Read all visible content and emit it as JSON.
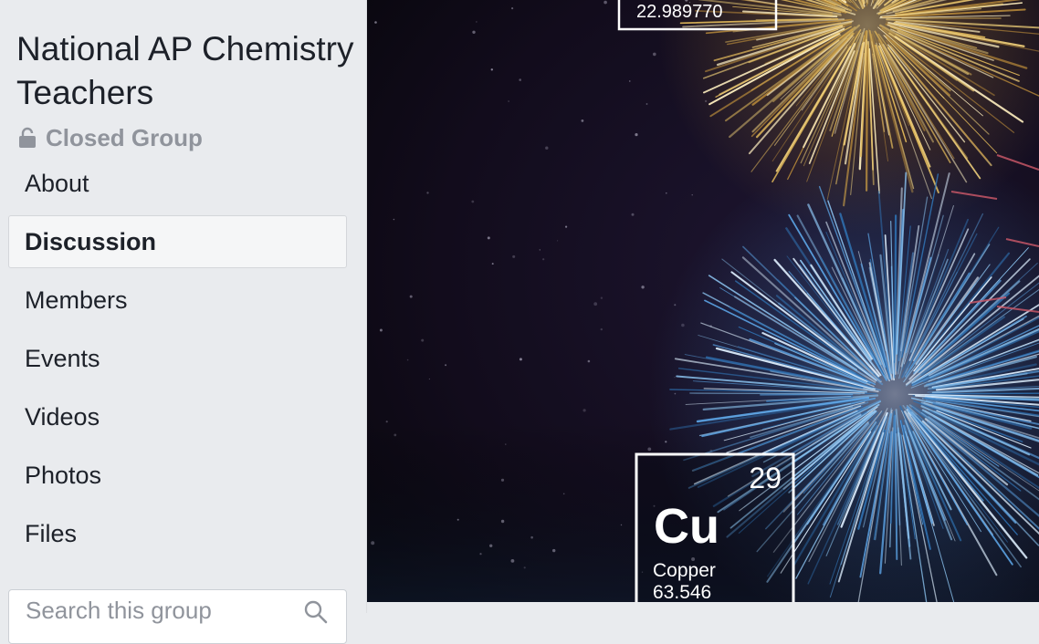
{
  "group": {
    "name": "National AP Chemistry Teachers",
    "privacy": "Closed Group"
  },
  "nav": {
    "items": [
      {
        "label": "About"
      },
      {
        "label": "Discussion"
      },
      {
        "label": "Members"
      },
      {
        "label": "Events"
      },
      {
        "label": "Videos"
      },
      {
        "label": "Photos"
      },
      {
        "label": "Files"
      }
    ],
    "active": "Discussion"
  },
  "search": {
    "placeholder": "Search this group"
  },
  "cover": {
    "sodium_tile": {
      "mass": "22.989770"
    },
    "copper_tile": {
      "number": "29",
      "symbol": "Cu",
      "name": "Copper",
      "mass": "63.546"
    }
  },
  "colors": {
    "sidebar_bg": "#e9ebee",
    "text": "#1d2129",
    "muted": "#90949c",
    "gold_firework": "#e0b85a",
    "blue_firework": "#5aa0e0"
  }
}
